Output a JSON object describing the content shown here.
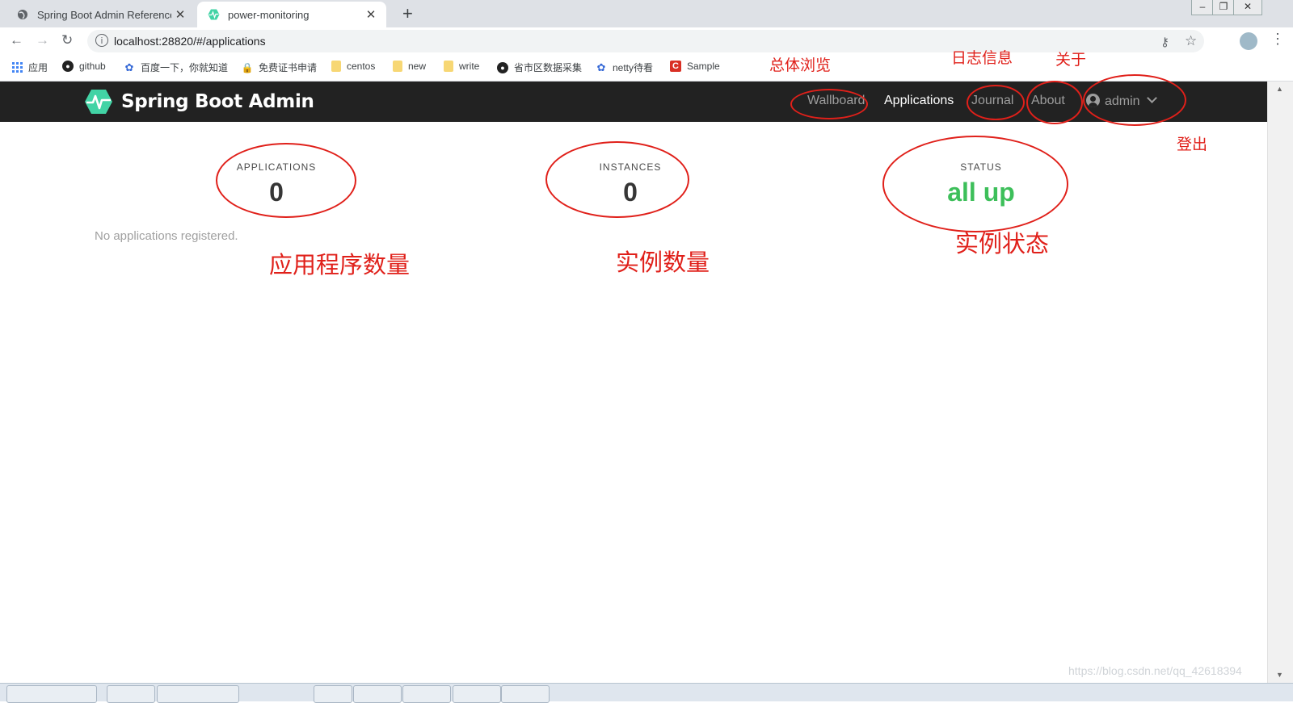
{
  "browser": {
    "tabs": [
      {
        "title": "Spring Boot Admin Reference",
        "active": false
      },
      {
        "title": "power-monitoring",
        "active": true
      }
    ],
    "new_tab": "+",
    "close_glyph": "✕",
    "url": "localhost:28820/#/applications",
    "bookmarks": [
      {
        "label": "应用",
        "icon": "apps-grid-icon"
      },
      {
        "label": "github",
        "icon": "github-icon"
      },
      {
        "label": "百度一下，你就知道",
        "icon": "baidu-paw-icon"
      },
      {
        "label": "免费证书申请",
        "icon": "lock-icon"
      },
      {
        "label": "centos",
        "icon": "folder-icon"
      },
      {
        "label": "new",
        "icon": "folder-icon"
      },
      {
        "label": "write",
        "icon": "folder-icon"
      },
      {
        "label": "省市区数据采集",
        "icon": "github-icon"
      },
      {
        "label": "netty待看",
        "icon": "baidu-paw-icon"
      },
      {
        "label": "Sample",
        "icon": "c-logo-icon"
      }
    ]
  },
  "app": {
    "brand": "Spring Boot Admin",
    "nav": {
      "wallboard": "Wallboard",
      "applications": "Applications",
      "journal": "Journal",
      "about": "About",
      "user": "admin"
    },
    "stats": {
      "applications_label": "APPLICATIONS",
      "applications_value": "0",
      "instances_label": "INSTANCES",
      "instances_value": "0",
      "status_label": "STATUS",
      "status_value": "all up"
    },
    "empty_message": "No applications registered.",
    "colors": {
      "navbar": "#222222",
      "status_up": "#3dbf5a",
      "brand_logo": "#42d3a5"
    }
  },
  "annotations": {
    "wallboard": "总体浏览",
    "journal": "日志信息",
    "about": "关于",
    "logout": "登出",
    "applications_count": "应用程序数量",
    "instances_count": "实例数量",
    "instance_status": "实例状态",
    "color": "#e0201a"
  },
  "watermark": "https://blog.csdn.net/qq_42618394"
}
